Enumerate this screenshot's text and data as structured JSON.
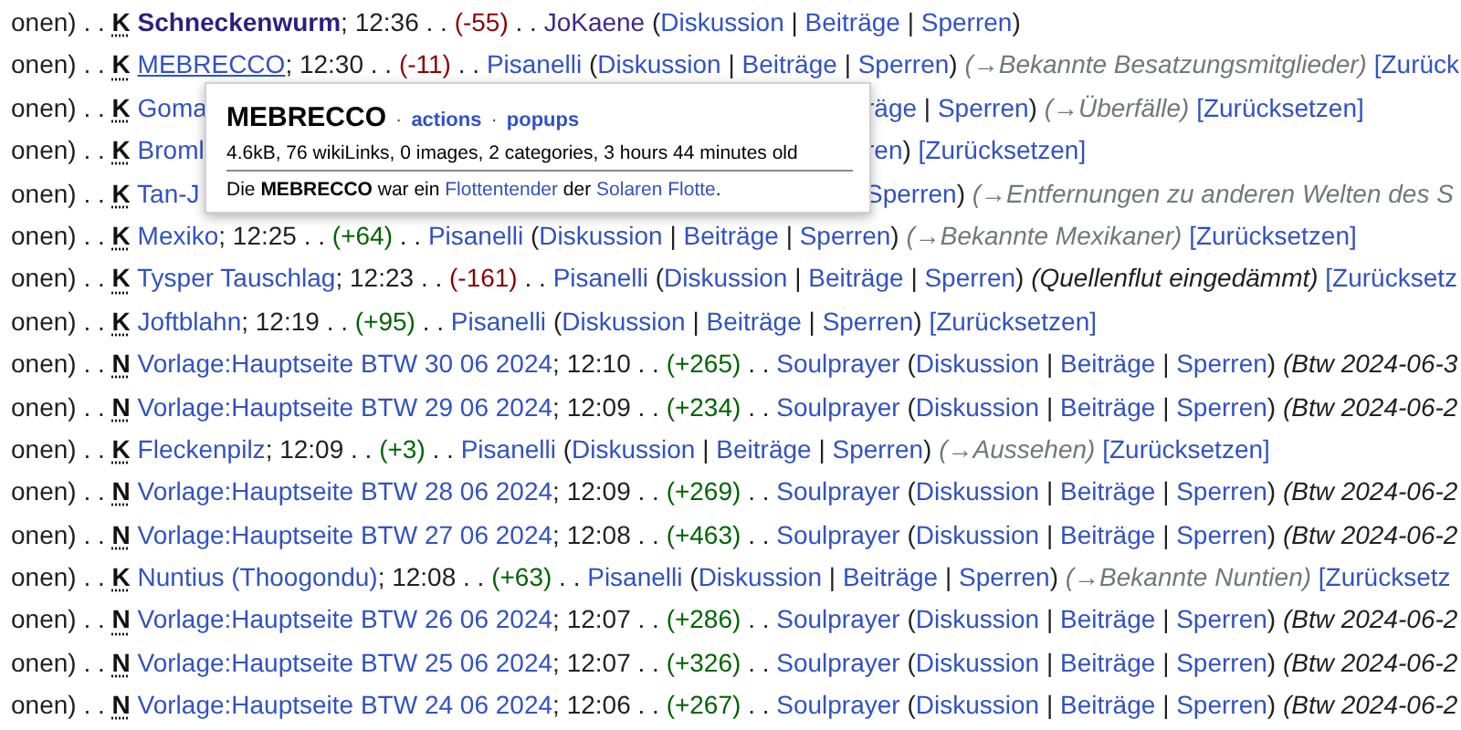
{
  "rows": [
    {
      "segments": [
        {
          "kind": "plain",
          "text": "onen) . . "
        },
        {
          "kind": "flag",
          "text": "K"
        },
        {
          "kind": "watched",
          "text": " Schneckenwurm"
        },
        {
          "kind": "plain",
          "text": "; 12:36 . . "
        },
        {
          "kind": "minus",
          "text": "(-55)"
        },
        {
          "kind": "plain",
          "text": " . . "
        },
        {
          "kind": "visited",
          "text": "JoKaene"
        },
        {
          "kind": "plain",
          "text": " ("
        },
        {
          "kind": "link",
          "text": "Diskussion"
        },
        {
          "kind": "plain",
          "text": " | "
        },
        {
          "kind": "link",
          "text": "Beiträge"
        },
        {
          "kind": "plain",
          "text": " | "
        },
        {
          "kind": "link",
          "text": "Sperren"
        },
        {
          "kind": "plain",
          "text": ")"
        }
      ]
    },
    {
      "segments": [
        {
          "kind": "plain",
          "text": "onen) . . "
        },
        {
          "kind": "flag",
          "text": "K"
        },
        {
          "kind": "hovered",
          "text": " MEBRECCO"
        },
        {
          "kind": "plain",
          "text": "; 12:30 . . "
        },
        {
          "kind": "minus",
          "text": "(-11)"
        },
        {
          "kind": "plain",
          "text": " . . "
        },
        {
          "kind": "link",
          "text": "Pisanelli"
        },
        {
          "kind": "plain",
          "text": " ("
        },
        {
          "kind": "link",
          "text": "Diskussion"
        },
        {
          "kind": "plain",
          "text": " | "
        },
        {
          "kind": "link",
          "text": "Beiträge"
        },
        {
          "kind": "plain",
          "text": " | "
        },
        {
          "kind": "link",
          "text": "Sperren"
        },
        {
          "kind": "plain",
          "text": ")"
        },
        {
          "kind": "section",
          "text": " (→Bekannte Besatzungsmitglieder)"
        },
        {
          "kind": "link",
          "text": " [Zurück"
        }
      ]
    },
    {
      "segments": [
        {
          "kind": "plain",
          "text": "onen) . . "
        },
        {
          "kind": "flag",
          "text": "K"
        },
        {
          "kind": "link",
          "text": " Goma"
        }
      ],
      "tail": [
        {
          "kind": "link",
          "text": "räge"
        },
        {
          "kind": "plain",
          "text": " | "
        },
        {
          "kind": "link",
          "text": "Sperren"
        },
        {
          "kind": "plain",
          "text": ")"
        },
        {
          "kind": "section",
          "text": " (→Überfälle)"
        },
        {
          "kind": "link",
          "text": " [Zurücksetzen]"
        }
      ]
    },
    {
      "segments": [
        {
          "kind": "plain",
          "text": "onen) . . "
        },
        {
          "kind": "flag",
          "text": "K"
        },
        {
          "kind": "link",
          "text": " Broml"
        }
      ],
      "tail": [
        {
          "kind": "link",
          "text": "ren"
        },
        {
          "kind": "plain",
          "text": ")"
        },
        {
          "kind": "link",
          "text": " [Zurücksetzen]"
        }
      ]
    },
    {
      "segments": [
        {
          "kind": "plain",
          "text": "onen) . . "
        },
        {
          "kind": "flag",
          "text": "K"
        },
        {
          "kind": "link",
          "text": " Tan-J"
        }
      ],
      "tail": [
        {
          "kind": "link",
          "text": "Sperren"
        },
        {
          "kind": "plain",
          "text": ")"
        },
        {
          "kind": "section",
          "text": " (→Entfernungen zu anderen Welten des S"
        }
      ]
    },
    {
      "segments": [
        {
          "kind": "plain",
          "text": "onen) . . "
        },
        {
          "kind": "flag",
          "text": "K"
        },
        {
          "kind": "link",
          "text": " Mexiko"
        },
        {
          "kind": "plain",
          "text": "; 12:25 . . "
        },
        {
          "kind": "plus",
          "text": "(+64)"
        },
        {
          "kind": "plain",
          "text": " . . "
        },
        {
          "kind": "link",
          "text": "Pisanelli"
        },
        {
          "kind": "plain",
          "text": " ("
        },
        {
          "kind": "link",
          "text": "Diskussion"
        },
        {
          "kind": "plain",
          "text": " | "
        },
        {
          "kind": "link",
          "text": "Beiträge"
        },
        {
          "kind": "plain",
          "text": " | "
        },
        {
          "kind": "link",
          "text": "Sperren"
        },
        {
          "kind": "plain",
          "text": ")"
        },
        {
          "kind": "section",
          "text": " (→Bekannte Mexikaner)"
        },
        {
          "kind": "link",
          "text": " [Zurücksetzen]"
        }
      ]
    },
    {
      "segments": [
        {
          "kind": "plain",
          "text": "onen) . . "
        },
        {
          "kind": "flag",
          "text": "K"
        },
        {
          "kind": "link",
          "text": " Tysper Tauschlag"
        },
        {
          "kind": "plain",
          "text": "; 12:23 . . "
        },
        {
          "kind": "minus",
          "text": "(-161)"
        },
        {
          "kind": "plain",
          "text": " . . "
        },
        {
          "kind": "link",
          "text": "Pisanelli"
        },
        {
          "kind": "plain",
          "text": " ("
        },
        {
          "kind": "link",
          "text": "Diskussion"
        },
        {
          "kind": "plain",
          "text": " | "
        },
        {
          "kind": "link",
          "text": "Beiträge"
        },
        {
          "kind": "plain",
          "text": " | "
        },
        {
          "kind": "link",
          "text": "Sperren"
        },
        {
          "kind": "plain",
          "text": ")"
        },
        {
          "kind": "comment",
          "text": " (Quellenflut eingedämmt)"
        },
        {
          "kind": "link",
          "text": " [Zurücksetz"
        }
      ]
    },
    {
      "segments": [
        {
          "kind": "plain",
          "text": "onen) . . "
        },
        {
          "kind": "flag",
          "text": "K"
        },
        {
          "kind": "link",
          "text": " Joftblahn"
        },
        {
          "kind": "plain",
          "text": "; 12:19 . . "
        },
        {
          "kind": "plus",
          "text": "(+95)"
        },
        {
          "kind": "plain",
          "text": " . . "
        },
        {
          "kind": "link",
          "text": "Pisanelli"
        },
        {
          "kind": "plain",
          "text": " ("
        },
        {
          "kind": "link",
          "text": "Diskussion"
        },
        {
          "kind": "plain",
          "text": " | "
        },
        {
          "kind": "link",
          "text": "Beiträge"
        },
        {
          "kind": "plain",
          "text": " | "
        },
        {
          "kind": "link",
          "text": "Sperren"
        },
        {
          "kind": "plain",
          "text": ")"
        },
        {
          "kind": "link",
          "text": " [Zurücksetzen]"
        }
      ]
    },
    {
      "segments": [
        {
          "kind": "plain",
          "text": "onen) . . "
        },
        {
          "kind": "flag",
          "text": "N"
        },
        {
          "kind": "link",
          "text": " Vorlage:Hauptseite BTW 30 06 2024"
        },
        {
          "kind": "plain",
          "text": "; 12:10 . . "
        },
        {
          "kind": "plus",
          "text": "(+265)"
        },
        {
          "kind": "plain",
          "text": " . . "
        },
        {
          "kind": "link",
          "text": "Soulprayer"
        },
        {
          "kind": "plain",
          "text": " ("
        },
        {
          "kind": "link",
          "text": "Diskussion"
        },
        {
          "kind": "plain",
          "text": " | "
        },
        {
          "kind": "link",
          "text": "Beiträge"
        },
        {
          "kind": "plain",
          "text": " | "
        },
        {
          "kind": "link",
          "text": "Sperren"
        },
        {
          "kind": "plain",
          "text": ")"
        },
        {
          "kind": "comment",
          "text": " (Btw 2024-06-3"
        }
      ]
    },
    {
      "segments": [
        {
          "kind": "plain",
          "text": "onen) . . "
        },
        {
          "kind": "flag",
          "text": "N"
        },
        {
          "kind": "link",
          "text": " Vorlage:Hauptseite BTW 29 06 2024"
        },
        {
          "kind": "plain",
          "text": "; 12:09 . . "
        },
        {
          "kind": "plus",
          "text": "(+234)"
        },
        {
          "kind": "plain",
          "text": " . . "
        },
        {
          "kind": "link",
          "text": "Soulprayer"
        },
        {
          "kind": "plain",
          "text": " ("
        },
        {
          "kind": "link",
          "text": "Diskussion"
        },
        {
          "kind": "plain",
          "text": " | "
        },
        {
          "kind": "link",
          "text": "Beiträge"
        },
        {
          "kind": "plain",
          "text": " | "
        },
        {
          "kind": "link",
          "text": "Sperren"
        },
        {
          "kind": "plain",
          "text": ")"
        },
        {
          "kind": "comment",
          "text": " (Btw 2024-06-2"
        }
      ]
    },
    {
      "segments": [
        {
          "kind": "plain",
          "text": "onen) . . "
        },
        {
          "kind": "flag",
          "text": "K"
        },
        {
          "kind": "link",
          "text": " Fleckenpilz"
        },
        {
          "kind": "plain",
          "text": "; 12:09 . . "
        },
        {
          "kind": "plus",
          "text": "(+3)"
        },
        {
          "kind": "plain",
          "text": " . . "
        },
        {
          "kind": "link",
          "text": "Pisanelli"
        },
        {
          "kind": "plain",
          "text": " ("
        },
        {
          "kind": "link",
          "text": "Diskussion"
        },
        {
          "kind": "plain",
          "text": " | "
        },
        {
          "kind": "link",
          "text": "Beiträge"
        },
        {
          "kind": "plain",
          "text": " | "
        },
        {
          "kind": "link",
          "text": "Sperren"
        },
        {
          "kind": "plain",
          "text": ")"
        },
        {
          "kind": "section",
          "text": " (→Aussehen)"
        },
        {
          "kind": "link",
          "text": " [Zurücksetzen]"
        }
      ]
    },
    {
      "segments": [
        {
          "kind": "plain",
          "text": "onen) . . "
        },
        {
          "kind": "flag",
          "text": "N"
        },
        {
          "kind": "link",
          "text": " Vorlage:Hauptseite BTW 28 06 2024"
        },
        {
          "kind": "plain",
          "text": "; 12:09 . . "
        },
        {
          "kind": "plus",
          "text": "(+269)"
        },
        {
          "kind": "plain",
          "text": " . . "
        },
        {
          "kind": "link",
          "text": "Soulprayer"
        },
        {
          "kind": "plain",
          "text": " ("
        },
        {
          "kind": "link",
          "text": "Diskussion"
        },
        {
          "kind": "plain",
          "text": " | "
        },
        {
          "kind": "link",
          "text": "Beiträge"
        },
        {
          "kind": "plain",
          "text": " | "
        },
        {
          "kind": "link",
          "text": "Sperren"
        },
        {
          "kind": "plain",
          "text": ")"
        },
        {
          "kind": "comment",
          "text": " (Btw 2024-06-2"
        }
      ]
    },
    {
      "segments": [
        {
          "kind": "plain",
          "text": "onen) . . "
        },
        {
          "kind": "flag",
          "text": "N"
        },
        {
          "kind": "link",
          "text": " Vorlage:Hauptseite BTW 27 06 2024"
        },
        {
          "kind": "plain",
          "text": "; 12:08 . . "
        },
        {
          "kind": "plus",
          "text": "(+463)"
        },
        {
          "kind": "plain",
          "text": " . . "
        },
        {
          "kind": "link",
          "text": "Soulprayer"
        },
        {
          "kind": "plain",
          "text": " ("
        },
        {
          "kind": "link",
          "text": "Diskussion"
        },
        {
          "kind": "plain",
          "text": " | "
        },
        {
          "kind": "link",
          "text": "Beiträge"
        },
        {
          "kind": "plain",
          "text": " | "
        },
        {
          "kind": "link",
          "text": "Sperren"
        },
        {
          "kind": "plain",
          "text": ")"
        },
        {
          "kind": "comment",
          "text": " (Btw 2024-06-2"
        }
      ]
    },
    {
      "segments": [
        {
          "kind": "plain",
          "text": "onen) . . "
        },
        {
          "kind": "flag",
          "text": "K"
        },
        {
          "kind": "link",
          "text": " Nuntius (Thoogondu)"
        },
        {
          "kind": "plain",
          "text": "; 12:08 . . "
        },
        {
          "kind": "plus",
          "text": "(+63)"
        },
        {
          "kind": "plain",
          "text": " . . "
        },
        {
          "kind": "link",
          "text": "Pisanelli"
        },
        {
          "kind": "plain",
          "text": " ("
        },
        {
          "kind": "link",
          "text": "Diskussion"
        },
        {
          "kind": "plain",
          "text": " | "
        },
        {
          "kind": "link",
          "text": "Beiträge"
        },
        {
          "kind": "plain",
          "text": " | "
        },
        {
          "kind": "link",
          "text": "Sperren"
        },
        {
          "kind": "plain",
          "text": ")"
        },
        {
          "kind": "section",
          "text": " (→Bekannte Nuntien)"
        },
        {
          "kind": "link",
          "text": " [Zurücksetz"
        }
      ]
    },
    {
      "segments": [
        {
          "kind": "plain",
          "text": "onen) . . "
        },
        {
          "kind": "flag",
          "text": "N"
        },
        {
          "kind": "link",
          "text": " Vorlage:Hauptseite BTW 26 06 2024"
        },
        {
          "kind": "plain",
          "text": "; 12:07 . . "
        },
        {
          "kind": "plus",
          "text": "(+286)"
        },
        {
          "kind": "plain",
          "text": " . . "
        },
        {
          "kind": "link",
          "text": "Soulprayer"
        },
        {
          "kind": "plain",
          "text": " ("
        },
        {
          "kind": "link",
          "text": "Diskussion"
        },
        {
          "kind": "plain",
          "text": " | "
        },
        {
          "kind": "link",
          "text": "Beiträge"
        },
        {
          "kind": "plain",
          "text": " | "
        },
        {
          "kind": "link",
          "text": "Sperren"
        },
        {
          "kind": "plain",
          "text": ")"
        },
        {
          "kind": "comment",
          "text": " (Btw 2024-06-2"
        }
      ]
    },
    {
      "segments": [
        {
          "kind": "plain",
          "text": "onen) . . "
        },
        {
          "kind": "flag",
          "text": "N"
        },
        {
          "kind": "link",
          "text": " Vorlage:Hauptseite BTW 25 06 2024"
        },
        {
          "kind": "plain",
          "text": "; 12:07 . . "
        },
        {
          "kind": "plus",
          "text": "(+326)"
        },
        {
          "kind": "plain",
          "text": " . . "
        },
        {
          "kind": "link",
          "text": "Soulprayer"
        },
        {
          "kind": "plain",
          "text": " ("
        },
        {
          "kind": "link",
          "text": "Diskussion"
        },
        {
          "kind": "plain",
          "text": " | "
        },
        {
          "kind": "link",
          "text": "Beiträge"
        },
        {
          "kind": "plain",
          "text": " | "
        },
        {
          "kind": "link",
          "text": "Sperren"
        },
        {
          "kind": "plain",
          "text": ")"
        },
        {
          "kind": "comment",
          "text": " (Btw 2024-06-2"
        }
      ]
    },
    {
      "segments": [
        {
          "kind": "plain",
          "text": "onen) . . "
        },
        {
          "kind": "flag",
          "text": "N"
        },
        {
          "kind": "link",
          "text": " Vorlage:Hauptseite BTW 24 06 2024"
        },
        {
          "kind": "plain",
          "text": "; 12:06 . . "
        },
        {
          "kind": "plus",
          "text": "(+267)"
        },
        {
          "kind": "plain",
          "text": " . . "
        },
        {
          "kind": "link",
          "text": "Soulprayer"
        },
        {
          "kind": "plain",
          "text": " ("
        },
        {
          "kind": "link",
          "text": "Diskussion"
        },
        {
          "kind": "plain",
          "text": " | "
        },
        {
          "kind": "link",
          "text": "Beiträge"
        },
        {
          "kind": "plain",
          "text": " | "
        },
        {
          "kind": "link",
          "text": "Sperren"
        },
        {
          "kind": "plain",
          "text": ")"
        },
        {
          "kind": "comment",
          "text": " (Btw 2024-06-2"
        }
      ]
    }
  ],
  "popup": {
    "title": "MEBRECCO",
    "menu": [
      {
        "kind": "sep",
        "text": "·"
      },
      {
        "kind": "link",
        "text": "actions"
      },
      {
        "kind": "sep",
        "text": "·"
      },
      {
        "kind": "link",
        "text": "popups"
      }
    ],
    "info": "4.6kB, 76 wikiLinks, 0 images, 2 categories, 3 hours 44 minutes old",
    "extract": [
      {
        "kind": "plain",
        "text": "Die "
      },
      {
        "kind": "bold",
        "text": "MEBRECCO"
      },
      {
        "kind": "plain",
        "text": " war ein "
      },
      {
        "kind": "link",
        "text": "Flottentender"
      },
      {
        "kind": "plain",
        "text": " der "
      },
      {
        "kind": "link",
        "text": "Solaren Flotte"
      },
      {
        "kind": "plain",
        "text": "."
      }
    ]
  }
}
